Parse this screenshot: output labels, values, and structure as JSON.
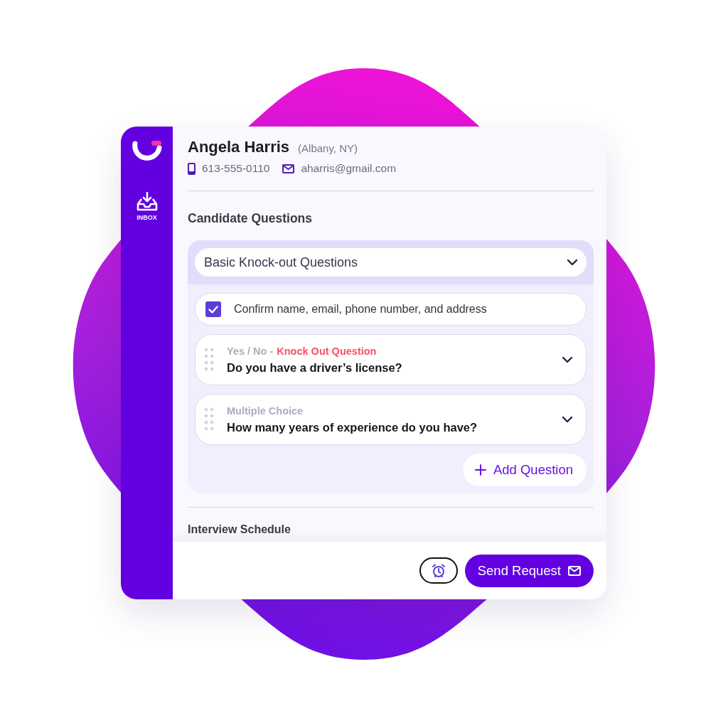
{
  "nav": [
    {
      "label": "INBOX"
    }
  ],
  "candidate": {
    "name": "Angela Harris",
    "location": "(Albany, NY)",
    "phone": "613-555-0110",
    "email": "aharris@gmail.com"
  },
  "section_title": "Candidate Questions",
  "question_set": {
    "value": "Basic Knock-out Questions"
  },
  "questions": [
    {
      "kind": "checkbox",
      "label": "Confirm name, email, phone number, and address",
      "checked": true
    },
    {
      "kind": "question",
      "type": "Yes / No -",
      "flag": "Knock Out Question",
      "text": "Do you have a driver’s license?"
    },
    {
      "kind": "question",
      "type": "Multiple Choice",
      "text": "How many years of experience do you have?"
    }
  ],
  "add_button": "Add Question",
  "next_section": "Interview Schedule",
  "send_button": "Send Request"
}
